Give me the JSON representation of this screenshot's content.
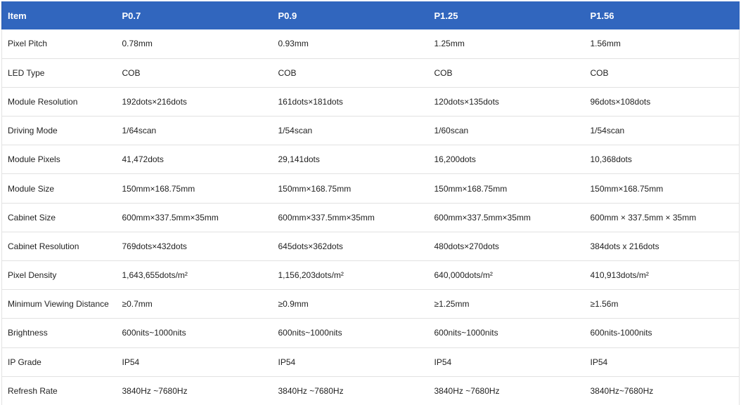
{
  "table": {
    "headers": [
      "Item",
      "P0.7",
      "P0.9",
      "P1.25",
      "P1.56"
    ],
    "rows": [
      [
        "Pixel Pitch",
        "0.78mm",
        "0.93mm",
        "1.25mm",
        "1.56mm"
      ],
      [
        "LED Type",
        "COB",
        "COB",
        "COB",
        "COB"
      ],
      [
        "Module Resolution",
        "192dots×216dots",
        "161dots×181dots",
        "120dots×135dots",
        "96dots×108dots"
      ],
      [
        "Driving Mode",
        "1/64scan",
        "1/54scan",
        "1/60scan",
        "1/54scan"
      ],
      [
        "Module Pixels",
        "41,472dots",
        "29,141dots",
        "16,200dots",
        "10,368dots"
      ],
      [
        "Module Size",
        "150mm×168.75mm",
        "150mm×168.75mm",
        "150mm×168.75mm",
        "150mm×168.75mm"
      ],
      [
        "Cabinet Size",
        "600mm×337.5mm×35mm",
        "600mm×337.5mm×35mm",
        "600mm×337.5mm×35mm",
        "600mm × 337.5mm × 35mm"
      ],
      [
        "Cabinet Resolution",
        "769dots×432dots",
        "645dots×362dots",
        "480dots×270dots",
        "384dots x 216dots"
      ],
      [
        "Pixel Density",
        "1,643,655dots/m²",
        "1,156,203dots/m²",
        "640,000dots/m²",
        "410,913dots/m²"
      ],
      [
        "Minimum Viewing Distance",
        "≥0.7mm",
        "≥0.9mm",
        "≥1.25mm",
        "≥1.56m"
      ],
      [
        "Brightness",
        "600nits~1000nits",
        "600nits~1000nits",
        "600nits~1000nits",
        "600nits-1000nits"
      ],
      [
        "IP Grade",
        "IP54",
        "IP54",
        "IP54",
        "IP54"
      ],
      [
        "Refresh Rate",
        "3840Hz ~7680Hz",
        "3840Hz ~7680Hz",
        "3840Hz ~7680Hz",
        "3840Hz~7680Hz"
      ]
    ]
  },
  "colors": {
    "header_bg": "#3166be",
    "header_text": "#ffffff",
    "row_divider": "#e2e2e2"
  }
}
